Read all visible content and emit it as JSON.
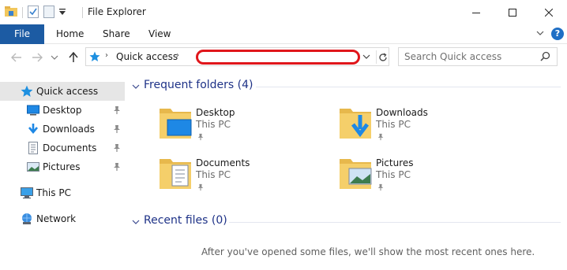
{
  "window": {
    "title": "File Explorer"
  },
  "ribbon": {
    "tabs": [
      "File",
      "Home",
      "Share",
      "View"
    ]
  },
  "address": {
    "location": "Quick access"
  },
  "search": {
    "placeholder": "Search Quick access"
  },
  "sidebar": {
    "items": [
      {
        "label": "Quick access",
        "icon": "star-icon"
      },
      {
        "label": "Desktop",
        "icon": "desktop-icon",
        "pinned": true
      },
      {
        "label": "Downloads",
        "icon": "download-icon",
        "pinned": true
      },
      {
        "label": "Documents",
        "icon": "documents-icon",
        "pinned": true
      },
      {
        "label": "Pictures",
        "icon": "pictures-icon",
        "pinned": true
      },
      {
        "label": "This PC",
        "icon": "computer-icon"
      },
      {
        "label": "Network",
        "icon": "network-icon"
      }
    ]
  },
  "frequent": {
    "heading": "Frequent folders (4)",
    "folders": [
      {
        "name": "Desktop",
        "location": "This PC"
      },
      {
        "name": "Downloads",
        "location": "This PC"
      },
      {
        "name": "Documents",
        "location": "This PC"
      },
      {
        "name": "Pictures",
        "location": "This PC"
      }
    ]
  },
  "recent": {
    "heading": "Recent files (0)",
    "empty_message": "After you've opened some files, we'll show the most recent ones here."
  },
  "colors": {
    "accent": "#1c5ba3",
    "heading": "#1e3287",
    "redaction": "#e0161b"
  }
}
